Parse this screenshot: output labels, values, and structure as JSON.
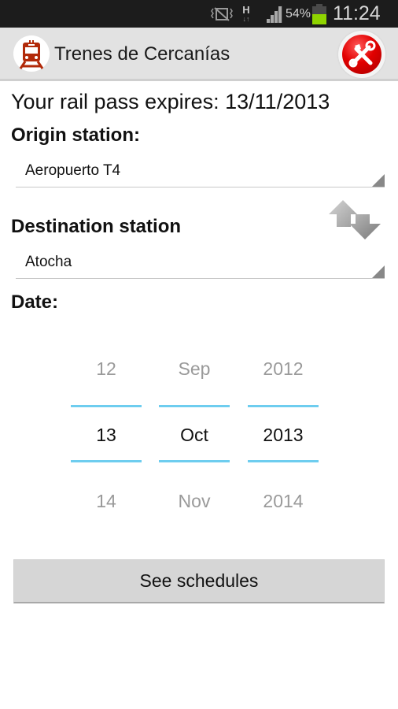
{
  "status_bar": {
    "icons": [
      "vibrate-mute-icon",
      "hspa-data-icon",
      "signal-icon",
      "battery-icon"
    ],
    "network_type": "H",
    "battery_percent": "54%",
    "battery_level": 0.54,
    "time": "11:24",
    "battery_color": "#8fd400"
  },
  "action_bar": {
    "app_icon": "train-icon",
    "title": "Trenes de Cercanías",
    "tools_icon": "tools-icon",
    "accent": "#d40000"
  },
  "main": {
    "expires_text": "Your rail pass expires: 13/11/2013",
    "origin_label": "Origin station:",
    "origin_value": "Aeropuerto T4",
    "destination_label": "Destination station",
    "destination_value": "Atocha",
    "swap_icon": "swap-arrows-icon",
    "date_label": "Date:",
    "date_picker": {
      "day": {
        "prev": "12",
        "current": "13",
        "next": "14"
      },
      "month": {
        "prev": "Sep",
        "current": "Oct",
        "next": "Nov"
      },
      "year": {
        "prev": "2012",
        "current": "2013",
        "next": "2014"
      },
      "divider_color": "#6ecdef"
    },
    "see_schedules_label": "See schedules"
  }
}
